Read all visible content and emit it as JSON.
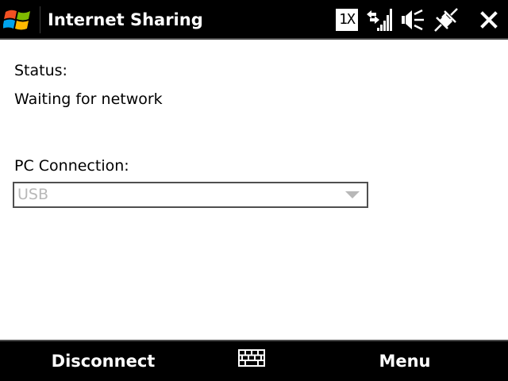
{
  "titlebar": {
    "title": "Internet Sharing",
    "icons": [
      "windows-start-icon",
      "1x-data-icon",
      "signal-strength-icon",
      "volume-muted-icon",
      "connection-icon",
      "close-icon"
    ],
    "data_indicator": "1X"
  },
  "main": {
    "status_label": "Status:",
    "status_value": "Waiting for network",
    "pc_connection_label": "PC Connection:",
    "pc_connection_value": "USB"
  },
  "softbar": {
    "left_label": "Disconnect",
    "right_label": "Menu",
    "center_icon": "keyboard-icon"
  }
}
